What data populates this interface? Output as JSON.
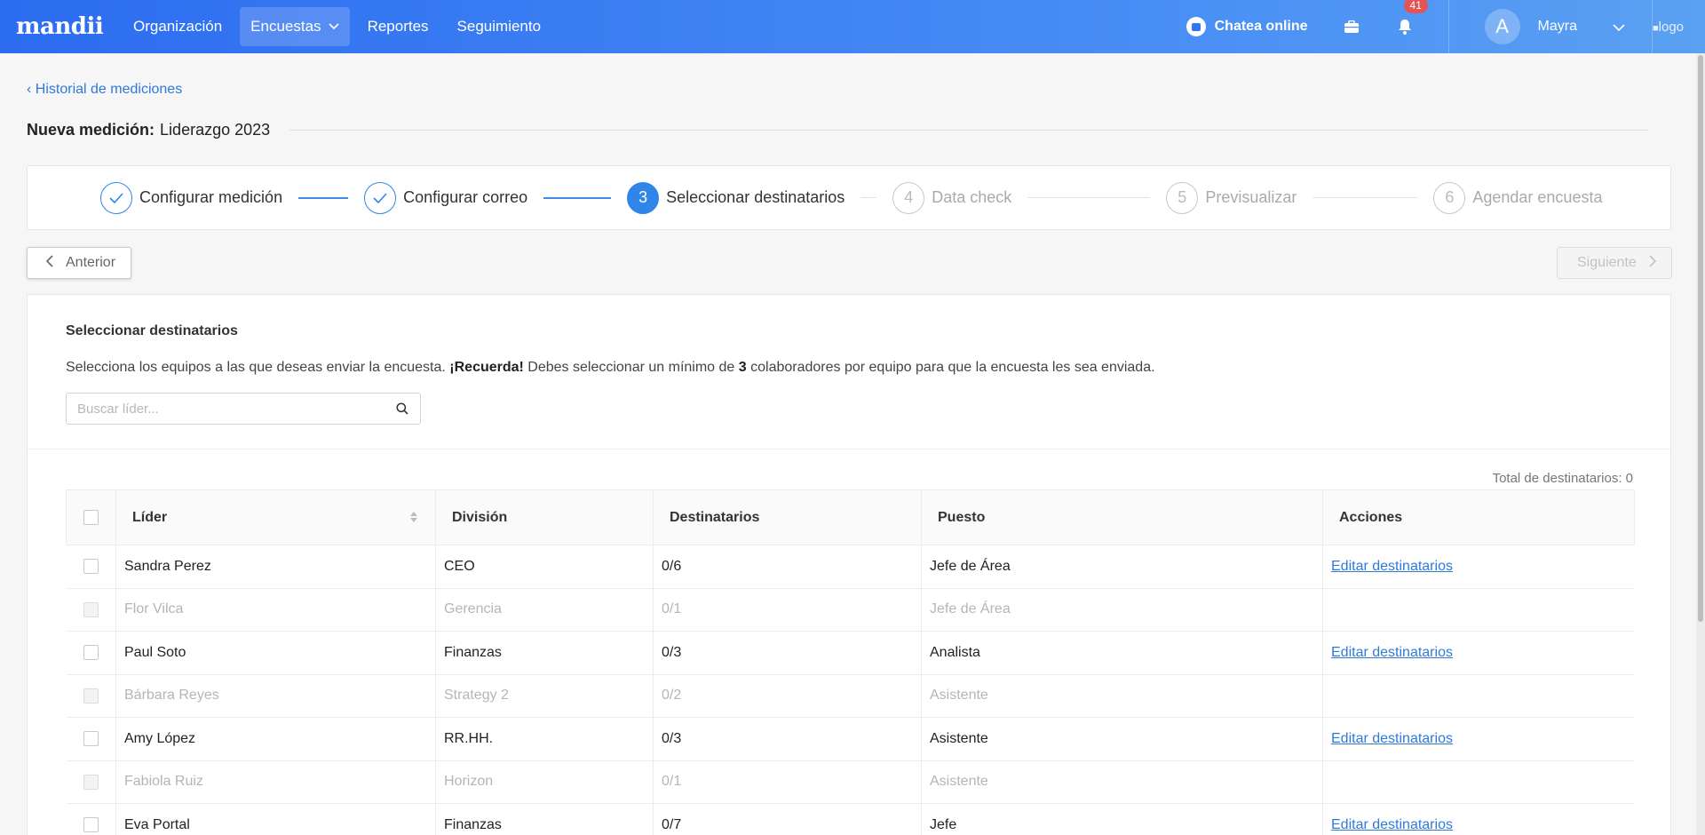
{
  "nav": {
    "brand": "mandii",
    "items": [
      "Organización",
      "Encuestas",
      "Reportes",
      "Seguimiento"
    ],
    "chat_label": "Chatea online",
    "notification_count": "41",
    "user_initial": "A",
    "user_name": "Mayra",
    "logo_alt": "logo"
  },
  "breadcrumb": {
    "back_label": "Historial de mediciones"
  },
  "title": {
    "prefix": "Nueva medición:",
    "name": "Liderazgo 2023"
  },
  "steps": [
    {
      "num": "1",
      "label": "Configurar medición",
      "state": "done"
    },
    {
      "num": "2",
      "label": "Configurar correo",
      "state": "done"
    },
    {
      "num": "3",
      "label": "Seleccionar destinatarios",
      "state": "current"
    },
    {
      "num": "4",
      "label": "Data check",
      "state": "pending"
    },
    {
      "num": "5",
      "label": "Previsualizar",
      "state": "pending"
    },
    {
      "num": "6",
      "label": "Agendar encuesta",
      "state": "pending"
    }
  ],
  "buttons": {
    "prev": "Anterior",
    "next": "Siguiente"
  },
  "panel": {
    "title": "Seleccionar destinatarios",
    "desc_start": "Selecciona los equipos a las que deseas enviar la encuesta. ",
    "desc_bold": "¡Recuerda!",
    "desc_mid": " Debes seleccionar un mínimo de ",
    "desc_num": "3",
    "desc_end": " colaboradores por equipo para que la encuesta les sea enviada.",
    "search_placeholder": "Buscar líder...",
    "total": "Total de destinatarios: 0"
  },
  "table": {
    "headers": [
      "Líder",
      "División",
      "Destinatarios",
      "Puesto",
      "Acciones"
    ],
    "action_label": "Editar destinatarios",
    "rows": [
      {
        "leader": "Sandra Perez",
        "division": "CEO",
        "recipients": "0/6",
        "role": "Jefe de Área",
        "enabled": true
      },
      {
        "leader": "Flor Vilca",
        "division": "Gerencia",
        "recipients": "0/1",
        "role": "Jefe de Área",
        "enabled": false
      },
      {
        "leader": "Paul Soto",
        "division": "Finanzas",
        "recipients": "0/3",
        "role": "Analista",
        "enabled": true
      },
      {
        "leader": "Bárbara Reyes",
        "division": "Strategy 2",
        "recipients": "0/2",
        "role": "Asistente",
        "enabled": false
      },
      {
        "leader": "Amy López",
        "division": "RR.HH.",
        "recipients": "0/3",
        "role": "Asistente",
        "enabled": true
      },
      {
        "leader": "Fabiola Ruiz",
        "division": "Horizon",
        "recipients": "0/1",
        "role": "Asistente",
        "enabled": false
      },
      {
        "leader": "Eva Portal",
        "division": "Finanzas",
        "recipients": "0/7",
        "role": "Jefe",
        "enabled": true
      }
    ]
  }
}
